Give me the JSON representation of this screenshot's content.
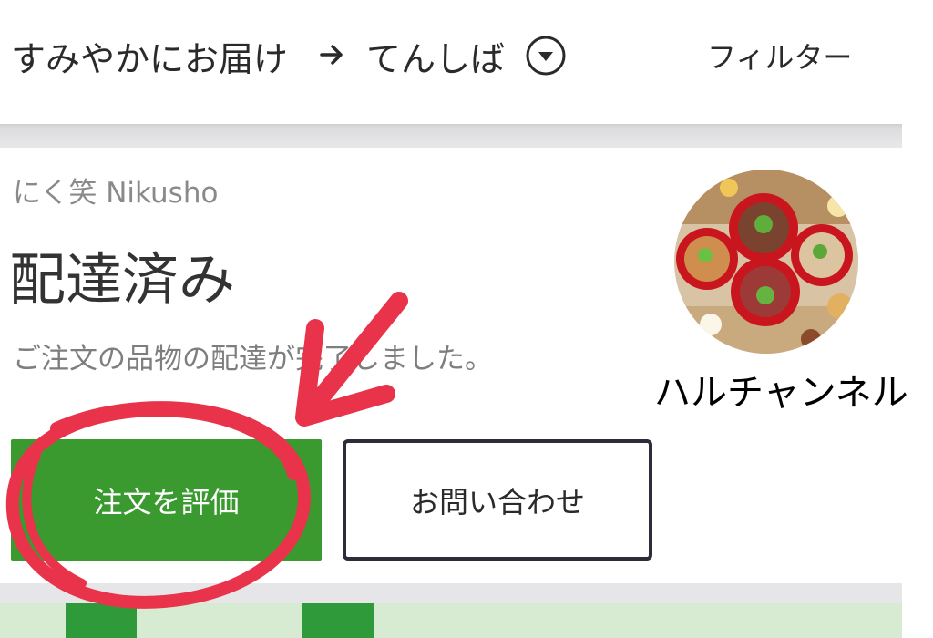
{
  "header": {
    "delivery_mode": "すみやかにお届け",
    "location": "てんしば",
    "filter_label": "フィルター",
    "arrow_glyph": "→",
    "arrow_icon": "right-arrow-icon",
    "dropdown_icon": "chevron-down-circle-icon"
  },
  "order": {
    "store_name": "にく笑 Nikusho",
    "status_title": "配達済み",
    "status_message": "ご注文の品物の配達が完了しました。",
    "rate_button_label": "注文を評価",
    "contact_button_label": "お問い合わせ"
  },
  "overlay": {
    "channel_name": "ハルチャンネル"
  },
  "colors": {
    "primary_green": "#3a9a2f",
    "annotation_red": "#e8334a",
    "text_dark": "#2a2a2a",
    "text_muted": "#8a8a8a"
  }
}
